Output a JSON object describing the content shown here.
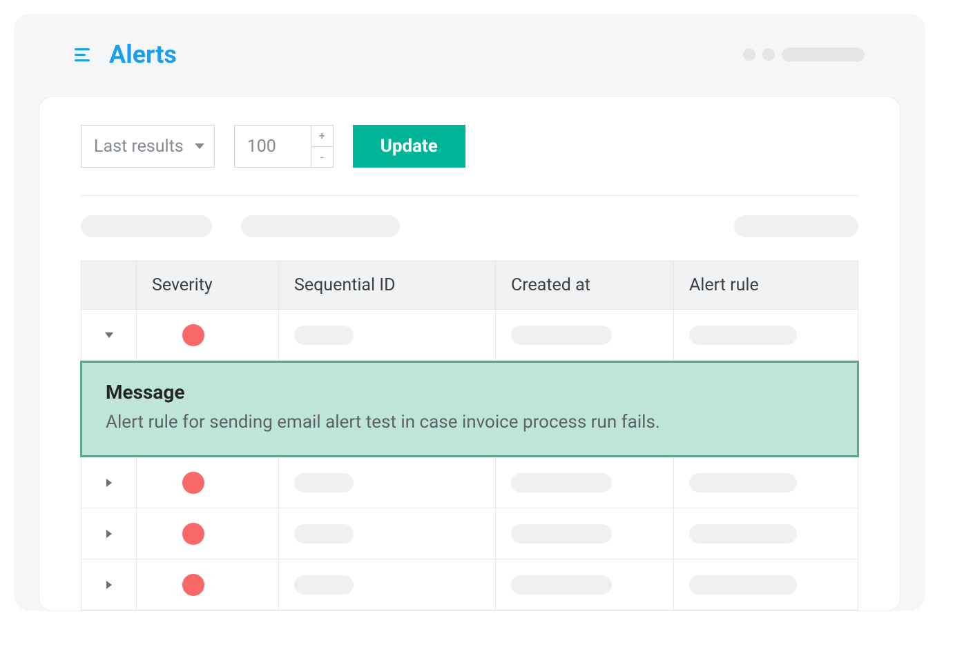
{
  "header": {
    "title": "Alerts"
  },
  "toolbar": {
    "filter_select": "Last results",
    "count_value": "100",
    "update_label": "Update"
  },
  "table": {
    "columns": {
      "severity": "Severity",
      "sequential_id": "Sequential ID",
      "created_at": "Created at",
      "alert_rule": "Alert rule"
    },
    "rows": [
      {
        "expanded": true,
        "severity_color": "#f86868",
        "message_title": "Message",
        "message_body": "Alert rule for sending email alert test in case invoice process run fails."
      },
      {
        "expanded": false,
        "severity_color": "#f86868"
      },
      {
        "expanded": false,
        "severity_color": "#f86868"
      },
      {
        "expanded": false,
        "severity_color": "#f86868"
      }
    ]
  }
}
